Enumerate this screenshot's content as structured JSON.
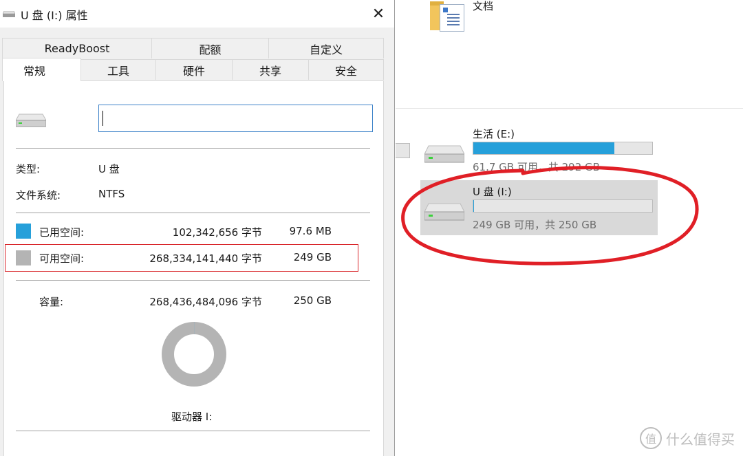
{
  "dialog": {
    "title": "U 盘 (I:) 属性",
    "close_glyph": "✕",
    "tabs_row1": [
      "ReadyBoost",
      "配额",
      "自定义"
    ],
    "tabs_row2": [
      "常规",
      "工具",
      "硬件",
      "共享",
      "安全"
    ],
    "active_tab": "常规",
    "name_input_value": "",
    "type_label": "类型:",
    "type_value": "U 盘",
    "fs_label": "文件系统:",
    "fs_value": "NTFS",
    "used_label": "已用空间:",
    "used_bytes": "102,342,656 字节",
    "used_size": "97.6 MB",
    "free_label": "可用空间:",
    "free_bytes": "268,334,141,440 字节",
    "free_size": "249 GB",
    "capacity_label": "容量:",
    "capacity_bytes": "268,436,484,096 字节",
    "capacity_size": "250 GB",
    "drive_label": "驱动器 I:",
    "used_fraction": 0.0004,
    "colors": {
      "used": "#26a0da",
      "free": "#b4b4b4",
      "highlight": "#d9262b"
    },
    "icons": {
      "title": "usb-drive-icon",
      "drive": "drive-icon",
      "close": "close-icon"
    }
  },
  "explorer": {
    "folder_label": "文档",
    "drives": [
      {
        "name": "生活 (E:)",
        "free_text": "61.7 GB 可用，共 292 GB",
        "used_fraction": 0.79,
        "selected": false
      },
      {
        "name": "U 盘 (I:)",
        "free_text": "249 GB 可用，共 250 GB",
        "used_fraction": 0.0004,
        "selected": true
      }
    ],
    "colors": {
      "bar_fill": "#26a0da",
      "circle": "#e01f26"
    }
  },
  "watermark": {
    "badge": "值",
    "text": "什么值得买"
  }
}
